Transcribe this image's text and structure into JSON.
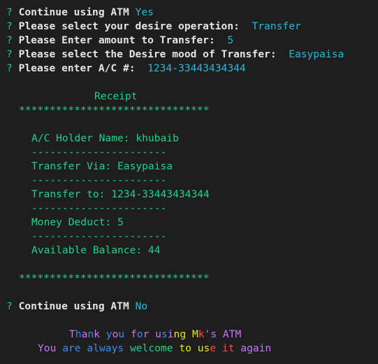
{
  "colors": {
    "background": "#1e1e1e",
    "prompt_marker": "#23d18b",
    "prompt_text": "#e5e5e5",
    "answer": "#29b8db",
    "receipt": "#23d18b",
    "rainbow": [
      "#cd74ff",
      "#3b8eea",
      "#e5e510",
      "#f14c4c",
      "#23d18b"
    ]
  },
  "prompts": [
    {
      "marker": "?",
      "label": "Continue using ATM",
      "sep": " ",
      "answer": "Yes"
    },
    {
      "marker": "?",
      "label": "Please select your desire operation:",
      "sep": "  ",
      "answer": "Transfer"
    },
    {
      "marker": "?",
      "label": "Please Enter amount to Transfer:",
      "sep": "  ",
      "answer": "5"
    },
    {
      "marker": "?",
      "label": "Please select the Desire mood of Transfer:",
      "sep": "  ",
      "answer": "Easypaisa"
    },
    {
      "marker": "?",
      "label": "Please enter A/C #:",
      "sep": "  ",
      "answer": "1234-33443434344"
    }
  ],
  "receipt": {
    "title": "Receipt",
    "stars": "*******************************",
    "divider": "----------------------",
    "holder": "A/C Holder Name: khubaib",
    "via": "Transfer Via: Easypaisa",
    "to": "Transfer to: 1234-33443434344",
    "deduct": "Money Deduct: 5",
    "balance": "Available Balance: 44"
  },
  "final_prompt": {
    "marker": "?",
    "label": "Continue using ATM",
    "sep": " ",
    "answer": "No"
  },
  "thanks": [
    {
      "t": "T",
      "c": "#cd74ff"
    },
    {
      "t": "h",
      "c": "#3b8eea"
    },
    {
      "t": "a",
      "c": "#cd74ff"
    },
    {
      "t": "n",
      "c": "#3b8eea"
    },
    {
      "t": "k",
      "c": "#cd74ff"
    },
    {
      "t": " ",
      "c": "#cd74ff"
    },
    {
      "t": "y",
      "c": "#3b8eea"
    },
    {
      "t": "o",
      "c": "#cd74ff"
    },
    {
      "t": "u",
      "c": "#3b8eea"
    },
    {
      "t": " ",
      "c": "#3b8eea"
    },
    {
      "t": "f",
      "c": "#cd74ff"
    },
    {
      "t": "o",
      "c": "#3b8eea"
    },
    {
      "t": "r",
      "c": "#cd74ff"
    },
    {
      "t": " ",
      "c": "#cd74ff"
    },
    {
      "t": "u",
      "c": "#cd74ff"
    },
    {
      "t": "s",
      "c": "#3b8eea"
    },
    {
      "t": "i",
      "c": "#cd74ff"
    },
    {
      "t": "n",
      "c": "#e5e510"
    },
    {
      "t": "g",
      "c": "#e5e510"
    },
    {
      "t": " ",
      "c": "#e5e510"
    },
    {
      "t": "M",
      "c": "#e5e510"
    },
    {
      "t": "k",
      "c": "#f14c4c"
    },
    {
      "t": "'",
      "c": "#cd74ff"
    },
    {
      "t": "s",
      "c": "#cd74ff"
    },
    {
      "t": " ",
      "c": "#cd74ff"
    },
    {
      "t": "A",
      "c": "#cd74ff"
    },
    {
      "t": "T",
      "c": "#cd74ff"
    },
    {
      "t": "M",
      "c": "#cd74ff"
    }
  ],
  "welcome": [
    {
      "t": "Y",
      "c": "#cd74ff"
    },
    {
      "t": "o",
      "c": "#cd74ff"
    },
    {
      "t": "u",
      "c": "#cd74ff"
    },
    {
      "t": " ",
      "c": "#cd74ff"
    },
    {
      "t": "a",
      "c": "#3b8eea"
    },
    {
      "t": "r",
      "c": "#3b8eea"
    },
    {
      "t": "e",
      "c": "#3b8eea"
    },
    {
      "t": " ",
      "c": "#3b8eea"
    },
    {
      "t": "a",
      "c": "#3b8eea"
    },
    {
      "t": "l",
      "c": "#3b8eea"
    },
    {
      "t": "w",
      "c": "#3b8eea"
    },
    {
      "t": "a",
      "c": "#3b8eea"
    },
    {
      "t": "y",
      "c": "#3b8eea"
    },
    {
      "t": "s",
      "c": "#3b8eea"
    },
    {
      "t": " ",
      "c": "#3b8eea"
    },
    {
      "t": "w",
      "c": "#23d18b"
    },
    {
      "t": "e",
      "c": "#23d18b"
    },
    {
      "t": "l",
      "c": "#23d18b"
    },
    {
      "t": "c",
      "c": "#23d18b"
    },
    {
      "t": "o",
      "c": "#23d18b"
    },
    {
      "t": "m",
      "c": "#23d18b"
    },
    {
      "t": "e",
      "c": "#23d18b"
    },
    {
      "t": " ",
      "c": "#23d18b"
    },
    {
      "t": "t",
      "c": "#e5e510"
    },
    {
      "t": "o",
      "c": "#e5e510"
    },
    {
      "t": " ",
      "c": "#e5e510"
    },
    {
      "t": "u",
      "c": "#e5e510"
    },
    {
      "t": "s",
      "c": "#e5e510"
    },
    {
      "t": "e",
      "c": "#f14c4c"
    },
    {
      "t": " ",
      "c": "#f14c4c"
    },
    {
      "t": "i",
      "c": "#f14c4c"
    },
    {
      "t": "t",
      "c": "#f14c4c"
    },
    {
      "t": " ",
      "c": "#f14c4c"
    },
    {
      "t": "a",
      "c": "#cd74ff"
    },
    {
      "t": "g",
      "c": "#cd74ff"
    },
    {
      "t": "a",
      "c": "#cd74ff"
    },
    {
      "t": "i",
      "c": "#cd74ff"
    },
    {
      "t": "n",
      "c": "#cd74ff"
    }
  ]
}
